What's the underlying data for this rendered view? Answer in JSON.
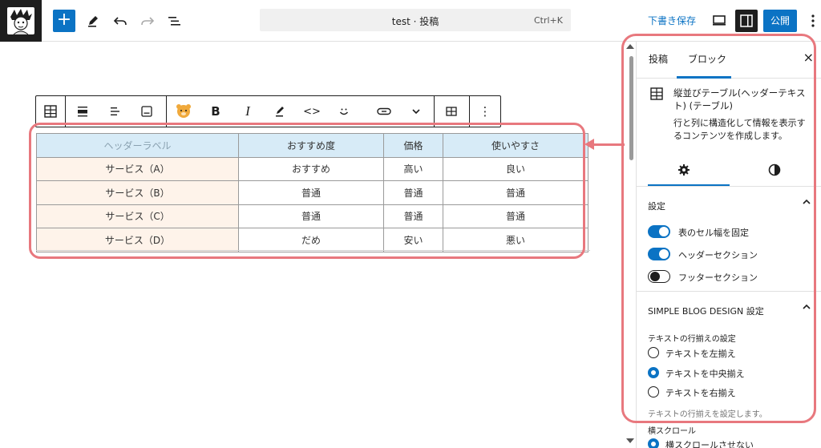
{
  "header": {
    "title": "test · 投稿",
    "shortcut": "Ctrl+K",
    "save_draft": "下書き保存",
    "publish": "公開",
    "add_symbol": "+"
  },
  "block_toolbar": {
    "bold": "B",
    "italic": "I",
    "code": "<>",
    "more": "⋮"
  },
  "table": {
    "headers": [
      "ヘッダーラベル",
      "おすすめ度",
      "価格",
      "使いやすさ"
    ],
    "rows": [
      [
        "サービス（A）",
        "おすすめ",
        "高い",
        "良い"
      ],
      [
        "サービス（B）",
        "普通",
        "普通",
        "普通"
      ],
      [
        "サービス（C）",
        "普通",
        "普通",
        "普通"
      ],
      [
        "サービス（D）",
        "だめ",
        "安い",
        "悪い"
      ]
    ]
  },
  "sidebar": {
    "tabs": [
      "投稿",
      "ブロック"
    ],
    "close": "×",
    "block_title": "縦並びテーブル(ヘッダーテキスト) (テーブル)",
    "block_desc": "行と列に構造化して情報を表示するコンテンツを作成します。",
    "settings": {
      "heading": "設定",
      "toggles": [
        {
          "label": "表のセル幅を固定",
          "on": true
        },
        {
          "label": "ヘッダーセクション",
          "on": true
        },
        {
          "label": "フッターセクション",
          "on": false
        }
      ]
    },
    "sbd": {
      "heading": "SIMPLE BLOG DESIGN 設定",
      "align_label": "テキストの行揃えの設定",
      "options": [
        {
          "label": "テキストを左揃え",
          "selected": false
        },
        {
          "label": "テキストを中央揃え",
          "selected": true
        },
        {
          "label": "テキストを右揃え",
          "selected": false
        }
      ],
      "help": "テキストの行揃えを設定します。",
      "scroll_label": "横スクロール",
      "scroll_option": "横スクロールさせない"
    }
  },
  "colors": {
    "accent": "#0b73c4",
    "highlight": "#e8787e",
    "header_fill": "#d7ebf7",
    "rowhead_fill": "#fef3ea"
  }
}
